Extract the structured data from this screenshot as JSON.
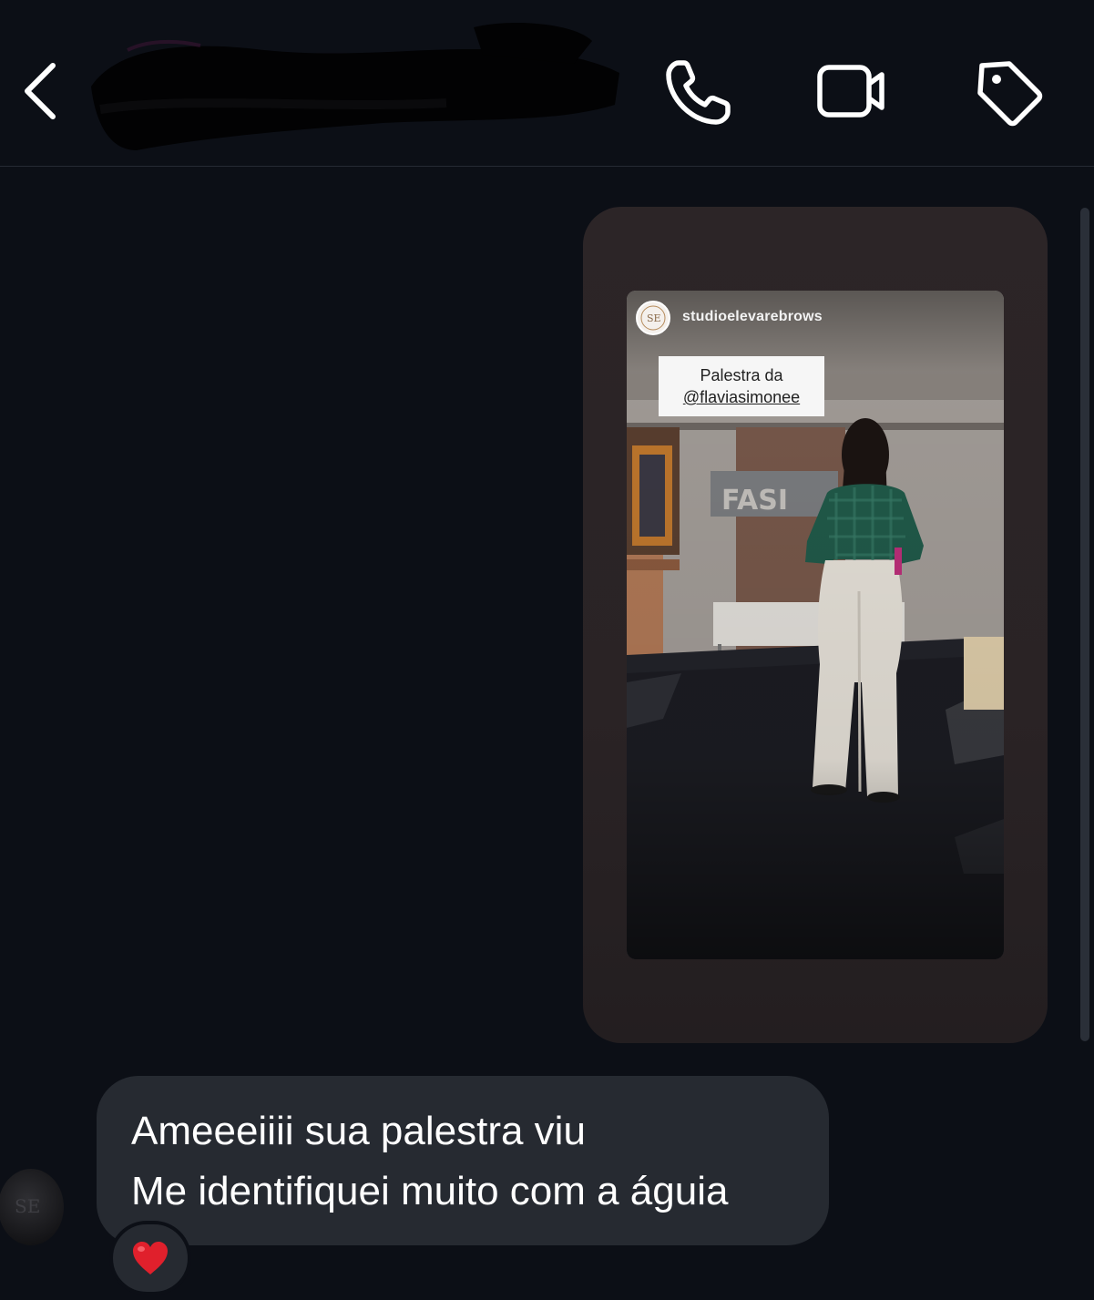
{
  "header": {
    "contact_name": "",
    "back_icon": "chevron-left-icon",
    "call_icon": "phone-icon",
    "video_icon": "video-camera-icon",
    "tag_icon": "tag-icon"
  },
  "story_reply": {
    "username": "studioelevarebrows",
    "caption_line1": "Palestra da",
    "caption_line2": "@flaviasimonee",
    "wall_sign": "FASI"
  },
  "message": {
    "line1": "Ameeeiiii sua palestra viu",
    "line2": "Me identifiquei muito com a águia",
    "reaction": "❤️"
  },
  "colors": {
    "background": "#0c0f16",
    "bubble": "#262a31",
    "story_bubble": "#2b2426",
    "reaction_red": "#e0202c"
  }
}
